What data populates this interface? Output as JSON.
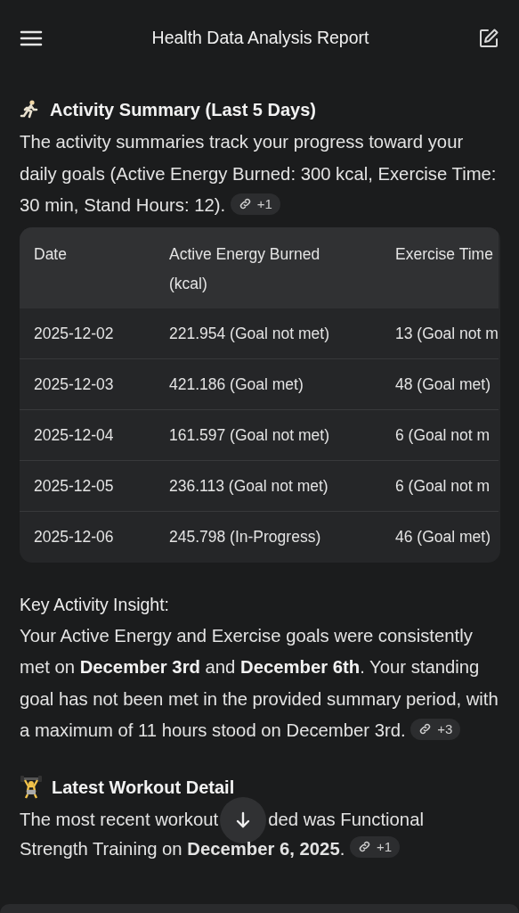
{
  "header": {
    "title": "Health Data Analysis Report"
  },
  "sections": [
    {
      "kind": "table",
      "heading": "Activity Summary (Last 5 Days)",
      "paragraph": "The activity summaries track your progress toward your daily goals (Active Energy Burned: 300 kcal, Exercise Time: 30 min, Stand Hours: 12).",
      "chip": "+1",
      "table": {
        "columns": [
          "Date",
          "Active Energy Burned (kcal)",
          "Exercise Time"
        ],
        "rows": [
          [
            "2025-12-02",
            "221.954 (Goal not met)",
            "13 (Goal not m"
          ],
          [
            "2025-12-03",
            "421.186 (Goal met)",
            "48 (Goal met)"
          ],
          [
            "2025-12-04",
            "161.597 (Goal not met)",
            "6 (Goal not m"
          ],
          [
            "2025-12-05",
            "236.113 (Goal not met)",
            "6 (Goal not m"
          ],
          [
            "2025-12-06",
            "245.798 (In-Progress)",
            "46 (Goal met)"
          ]
        ]
      },
      "insight_title": "Key Activity Insight:",
      "insight": "Your Active Energy and Exercise goals were consistently met on **December 3rd** and **December 6th**. Your standing goal has not been met in the provided summary period, with a maximum of 11 hours stood on December 3rd.",
      "insight_chip": "+3"
    },
    {
      "kind": "text",
      "heading": "Latest Workout Detail",
      "line_parts": [
        "The most recent workout",
        "ded was Functional"
      ],
      "line_2": "Strength Training on **December 6, 2025**.",
      "chip": "+1"
    }
  ]
}
